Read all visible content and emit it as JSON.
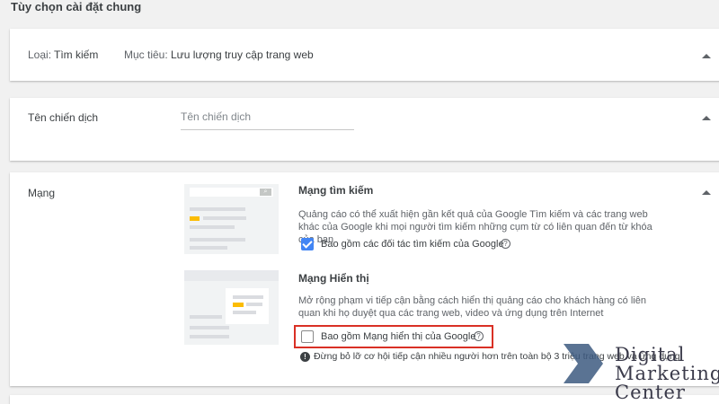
{
  "page": {
    "section_title": "Tùy chọn cài đặt chung"
  },
  "campaign_type": {
    "type_label": "Loại:",
    "type_value": "Tìm kiếm",
    "goal_label": "Mục tiêu:",
    "goal_value": "Lưu lượng truy cập trang web"
  },
  "campaign_name": {
    "label": "Tên chiến dịch",
    "placeholder": "Tên chiến dịch"
  },
  "networks": {
    "label": "Mạng",
    "search": {
      "title": "Mạng tìm kiếm",
      "description": "Quảng cáo có thể xuất hiện gần kết quả của Google Tìm kiếm và các trang web khác của Google khi mọi người tìm kiếm những cụm từ có liên quan đến từ khóa của bạn",
      "checkbox_label": "Bao gồm các đối tác tìm kiếm của Google",
      "checked": true
    },
    "display": {
      "title": "Mạng Hiển thị",
      "description": "Mở rộng phạm vi tiếp cận bằng cách hiển thị quảng cáo cho khách hàng có liên quan khi họ duyệt qua các trang web, video và ứng dụng trên Internet",
      "checkbox_label": "Bao gồm Mạng hiển thị của Google",
      "checked": false,
      "notice": "Đừng bỏ lỡ cơ hội tiếp cận nhiều người hơn trên toàn bộ 3 triệu trang web và ứng dụng"
    }
  },
  "watermark": {
    "line1": "Digital",
    "line2": "Marketing",
    "line3": "Center"
  },
  "icons": {
    "help": "?",
    "info": "!",
    "search": "⌕"
  },
  "colors": {
    "accent": "#4285f4",
    "highlight": "#d93025",
    "thumb_accent": "#fbbc04"
  }
}
